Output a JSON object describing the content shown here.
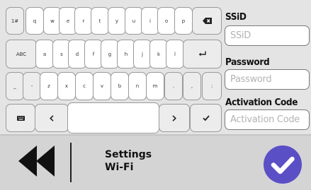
{
  "keyboard": {
    "row1": [
      "1#",
      "q",
      "w",
      "e",
      "r",
      "t",
      "y",
      "u",
      "i",
      "o",
      "p"
    ],
    "row2_mode": "ABC",
    "row2": [
      "a",
      "s",
      "d",
      "f",
      "g",
      "h",
      "j",
      "k",
      "l"
    ],
    "row3": [
      "_",
      "-",
      "z",
      "x",
      "c",
      "v",
      "b",
      "n",
      "m",
      ".",
      ",",
      ":"
    ],
    "icons": {
      "backspace": "backspace-icon",
      "enter": "enter-icon",
      "keyboard": "keyboard-icon",
      "left": "chevron-left-icon",
      "right": "chevron-right-icon",
      "check": "checkmark-icon"
    }
  },
  "form": {
    "ssid": {
      "label": "SSiD",
      "placeholder": "SSiD"
    },
    "password": {
      "label": "Password",
      "placeholder": "Password"
    },
    "activation": {
      "label": "Activation Code",
      "placeholder": "Activation Code"
    }
  },
  "footer": {
    "back_icon": "rewind-icon",
    "title": "Settings",
    "subtitle": "Wi-Fi",
    "confirm_icon": "confirm-check-icon"
  },
  "colors": {
    "accent": "#5b4fc6",
    "text": "#111111",
    "placeholder": "#b3b3b3"
  }
}
